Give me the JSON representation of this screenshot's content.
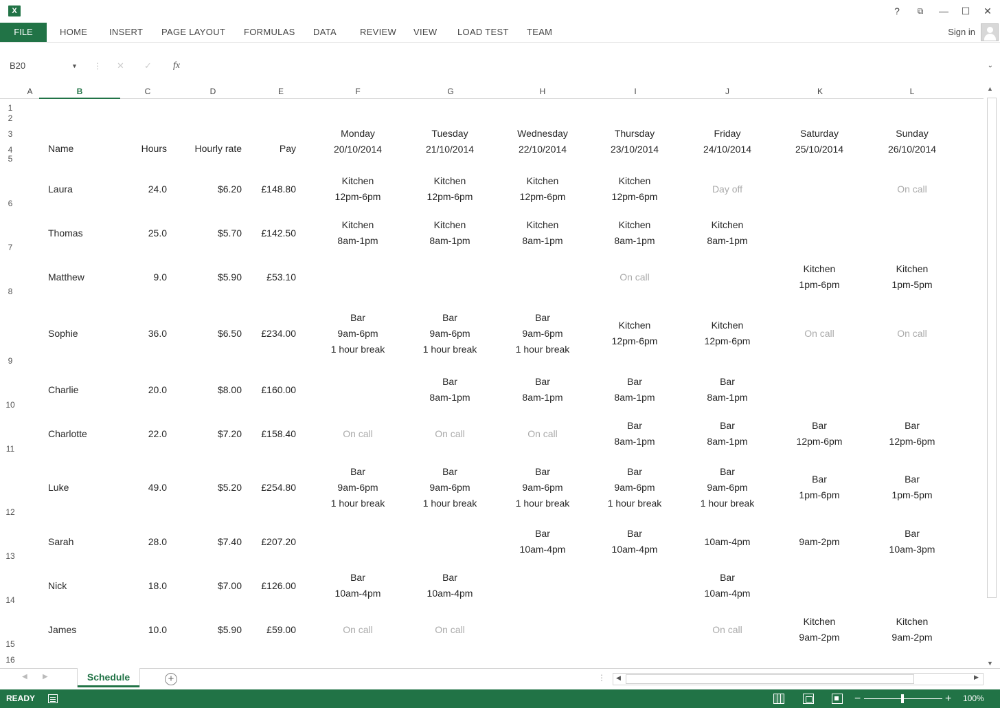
{
  "app": {
    "icon_text": "X",
    "help": "?",
    "restore": "⧉",
    "minimize": "—",
    "maximize": "☐",
    "close": "✕"
  },
  "ribbon": {
    "file": "FILE",
    "tabs": [
      "HOME",
      "INSERT",
      "PAGE LAYOUT",
      "FORMULAS",
      "DATA",
      "REVIEW",
      "VIEW",
      "LOAD TEST",
      "TEAM"
    ],
    "signin": "Sign in"
  },
  "formula_bar": {
    "name_box": "B20",
    "value": ""
  },
  "columns": [
    "A",
    "B",
    "C",
    "D",
    "E",
    "F",
    "G",
    "H",
    "I",
    "J",
    "K",
    "L"
  ],
  "active_column": "B",
  "rows": [
    "1",
    "2",
    "3",
    "4",
    "5",
    "6",
    "7",
    "8",
    "9",
    "10",
    "11",
    "12",
    "13",
    "14",
    "15",
    "16"
  ],
  "header": {
    "name": "Name",
    "hours": "Hours",
    "rate": "Hourly rate",
    "pay": "Pay",
    "days": [
      {
        "day": "Monday",
        "date": "20/10/2014"
      },
      {
        "day": "Tuesday",
        "date": "21/10/2014"
      },
      {
        "day": "Wednesday",
        "date": "22/10/2014"
      },
      {
        "day": "Thursday",
        "date": "23/10/2014"
      },
      {
        "day": "Friday",
        "date": "24/10/2014"
      },
      {
        "day": "Saturday",
        "date": "25/10/2014"
      },
      {
        "day": "Sunday",
        "date": "26/10/2014"
      }
    ]
  },
  "staff": [
    {
      "name": "Laura",
      "hours": "24.0",
      "rate": "$6.20",
      "pay": "£148.80",
      "shifts": [
        [
          "Kitchen",
          "12pm-6pm"
        ],
        [
          "Kitchen",
          "12pm-6pm"
        ],
        [
          "Kitchen",
          "12pm-6pm"
        ],
        [
          "Kitchen",
          "12pm-6pm"
        ],
        [
          "Day off"
        ],
        [],
        [
          "On call"
        ]
      ]
    },
    {
      "name": "Thomas",
      "hours": "25.0",
      "rate": "$5.70",
      "pay": "£142.50",
      "shifts": [
        [
          "Kitchen",
          "8am-1pm"
        ],
        [
          "Kitchen",
          "8am-1pm"
        ],
        [
          "Kitchen",
          "8am-1pm"
        ],
        [
          "Kitchen",
          "8am-1pm"
        ],
        [
          "Kitchen",
          "8am-1pm"
        ],
        [],
        []
      ]
    },
    {
      "name": "Matthew",
      "hours": "9.0",
      "rate": "$5.90",
      "pay": "£53.10",
      "shifts": [
        [],
        [],
        [],
        [
          "On call"
        ],
        [],
        [
          "Kitchen",
          "1pm-6pm"
        ],
        [
          "Kitchen",
          "1pm-5pm"
        ]
      ]
    },
    {
      "name": "Sophie",
      "hours": "36.0",
      "rate": "$6.50",
      "pay": "£234.00",
      "shifts": [
        [
          "Bar",
          "9am-6pm",
          "1 hour break"
        ],
        [
          "Bar",
          "9am-6pm",
          "1 hour break"
        ],
        [
          "Bar",
          "9am-6pm",
          "1 hour break"
        ],
        [
          "Kitchen",
          "12pm-6pm"
        ],
        [
          "Kitchen",
          "12pm-6pm"
        ],
        [
          "On call"
        ],
        [
          "On call"
        ]
      ]
    },
    {
      "name": "Charlie",
      "hours": "20.0",
      "rate": "$8.00",
      "pay": "£160.00",
      "shifts": [
        [],
        [
          "Bar",
          "8am-1pm"
        ],
        [
          "Bar",
          "8am-1pm"
        ],
        [
          "Bar",
          "8am-1pm"
        ],
        [
          "Bar",
          "8am-1pm"
        ],
        [],
        []
      ]
    },
    {
      "name": "Charlotte",
      "hours": "22.0",
      "rate": "$7.20",
      "pay": "£158.40",
      "shifts": [
        [
          "On call"
        ],
        [
          "On call"
        ],
        [
          "On call"
        ],
        [
          "Bar",
          "8am-1pm"
        ],
        [
          "Bar",
          "8am-1pm"
        ],
        [
          "Bar",
          "12pm-6pm"
        ],
        [
          "Bar",
          "12pm-6pm"
        ]
      ]
    },
    {
      "name": "Luke",
      "hours": "49.0",
      "rate": "$5.20",
      "pay": "£254.80",
      "shifts": [
        [
          "Bar",
          "9am-6pm",
          "1 hour break"
        ],
        [
          "Bar",
          "9am-6pm",
          "1 hour break"
        ],
        [
          "Bar",
          "9am-6pm",
          "1 hour break"
        ],
        [
          "Bar",
          "9am-6pm",
          "1 hour break"
        ],
        [
          "Bar",
          "9am-6pm",
          "1 hour break"
        ],
        [
          "Bar",
          "1pm-6pm"
        ],
        [
          "Bar",
          "1pm-5pm"
        ]
      ]
    },
    {
      "name": "Sarah",
      "hours": "28.0",
      "rate": "$7.40",
      "pay": "£207.20",
      "shifts": [
        [],
        [],
        [
          "Bar",
          "10am-4pm"
        ],
        [
          "Bar",
          "10am-4pm"
        ],
        [
          "10am-4pm"
        ],
        [
          "9am-2pm"
        ],
        [
          "Bar",
          "10am-3pm"
        ]
      ]
    },
    {
      "name": "Nick",
      "hours": "18.0",
      "rate": "$7.00",
      "pay": "£126.00",
      "shifts": [
        [
          "Bar",
          "10am-4pm"
        ],
        [
          "Bar",
          "10am-4pm"
        ],
        [],
        [],
        [
          "Bar",
          "10am-4pm"
        ],
        [],
        []
      ]
    },
    {
      "name": "James",
      "hours": "10.0",
      "rate": "$5.90",
      "pay": "£59.00",
      "shifts": [
        [
          "On call"
        ],
        [
          "On call"
        ],
        [],
        [],
        [
          "On call"
        ],
        [
          "Kitchen",
          "9am-2pm"
        ],
        [
          "Kitchen",
          "9am-2pm"
        ]
      ]
    }
  ],
  "muted_values": [
    "On call",
    "Day off"
  ],
  "sheet_tabs": {
    "active": "Schedule",
    "add": "+"
  },
  "status": {
    "ready": "READY",
    "zoom": "100%",
    "zoom_fraction": 0.5
  },
  "colors": {
    "accent": "#217346",
    "muted_text": "#aaaaaa",
    "text": "#262626"
  }
}
